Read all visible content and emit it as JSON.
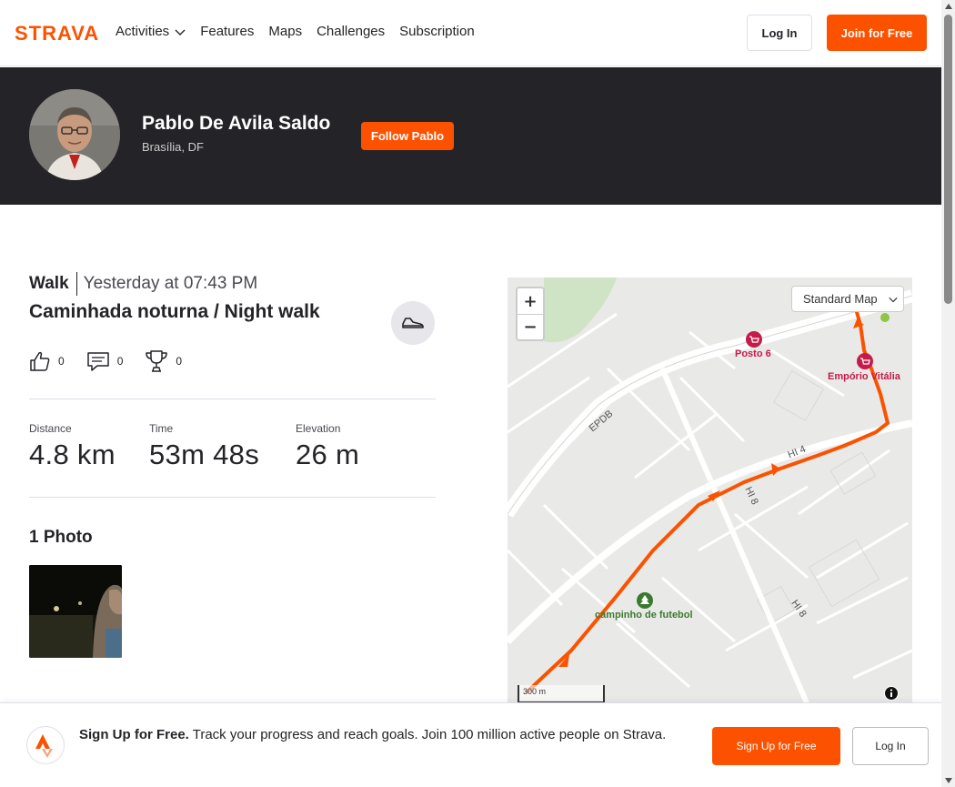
{
  "brand": {
    "logo_text": "STRAVA",
    "accent": "#fc5200"
  },
  "nav": {
    "items": [
      {
        "label": "Activities",
        "has_dropdown": true
      },
      {
        "label": "Features"
      },
      {
        "label": "Maps"
      },
      {
        "label": "Challenges"
      },
      {
        "label": "Subscription"
      }
    ],
    "login_label": "Log In",
    "join_label": "Join for Free"
  },
  "athlete": {
    "name": "Pablo De Avila Saldo",
    "location": "Brasília, DF",
    "follow_label": "Follow Pablo"
  },
  "activity": {
    "type": "Walk",
    "when": "Yesterday at 07:43 PM",
    "title": "Caminhada noturna / Night walk",
    "kudos": "0",
    "comments": "0",
    "achievements": "0",
    "stats": [
      {
        "label": "Distance",
        "value": "4.8 km"
      },
      {
        "label": "Time",
        "value": "53m 48s"
      },
      {
        "label": "Elevation",
        "value": "26 m"
      }
    ]
  },
  "photos": {
    "heading": "1 Photo"
  },
  "map": {
    "style_label": "Standard Map",
    "zoom_in": "+",
    "zoom_out": "−",
    "scale_label": "300 m",
    "labels": {
      "poi_posto": "Posto 6",
      "poi_emporio": "Empório Vitália",
      "poi_campinho": "campinho de futebol",
      "road_epdb": "EPDB",
      "road_hi4": "HI 4",
      "road_hi8a": "HI 8",
      "road_hi8b": "HI 8"
    },
    "route_color": "#fc5200"
  },
  "cta": {
    "bold": "Sign Up for Free.",
    "text": " Track your progress and reach goals. Join 100 million active people on Strava.",
    "signup_label": "Sign Up for Free",
    "login_label": "Log In"
  }
}
